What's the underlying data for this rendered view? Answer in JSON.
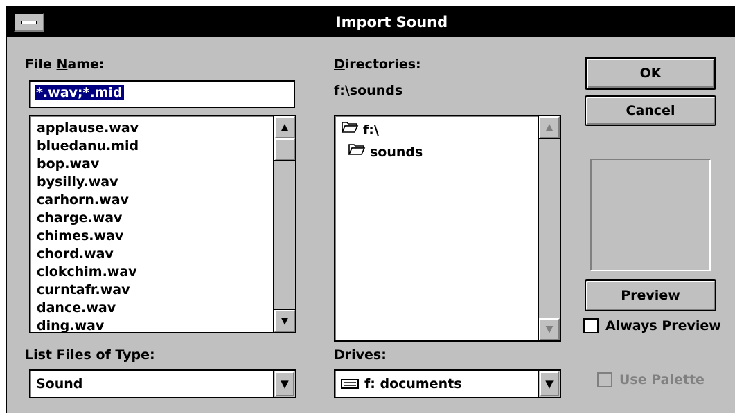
{
  "window": {
    "title": "Import Sound"
  },
  "file_name": {
    "label_pre": "File ",
    "label_u": "N",
    "label_post": "ame:",
    "value": "*.wav;*.mid"
  },
  "file_list": {
    "items": [
      "applause.wav",
      "bluedanu.mid",
      "bop.wav",
      "bysilly.wav",
      "carhorn.wav",
      "charge.wav",
      "chimes.wav",
      "chord.wav",
      "clokchim.wav",
      "curntafr.wav",
      "dance.wav",
      "ding.wav"
    ]
  },
  "file_type": {
    "label_pre": "List Files of ",
    "label_u": "T",
    "label_post": "ype:",
    "value": "Sound"
  },
  "directories": {
    "label_u": "D",
    "label_post": "irectories:",
    "current_path": "f:\\sounds",
    "items": [
      {
        "name": "f:\\",
        "icon": "open-folder-icon"
      },
      {
        "name": "sounds",
        "icon": "open-folder-icon"
      }
    ]
  },
  "drives": {
    "label_pre": "Dri",
    "label_u": "v",
    "label_post": "es:",
    "value": "f: documents",
    "icon": "network-drive-icon"
  },
  "buttons": {
    "ok": "OK",
    "cancel": "Cancel",
    "preview": "Preview"
  },
  "checkboxes": {
    "always_preview": "Always Preview",
    "use_palette": "Use Palette"
  },
  "icons": {
    "scroll_up": "▲",
    "scroll_down": "▼",
    "dropdown": "▼"
  },
  "colors": {
    "face": "#c0c0c0",
    "titlebar": "#000000",
    "selection": "#000080",
    "disabled_text": "#808080"
  }
}
